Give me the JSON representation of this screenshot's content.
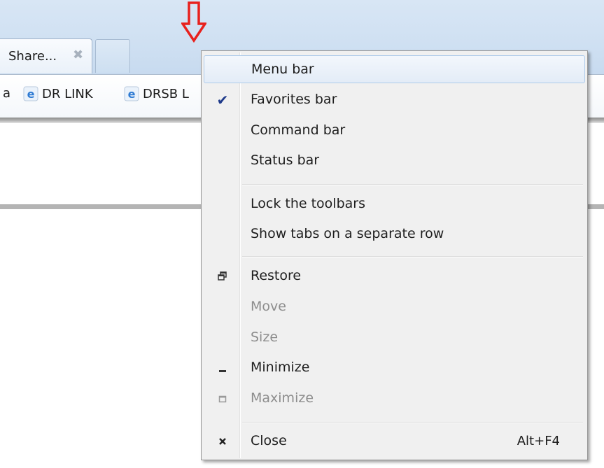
{
  "tab": {
    "label": "Share...",
    "close_glyph": "✖"
  },
  "favorites": [
    {
      "label": "a"
    },
    {
      "label": "DR LINK",
      "icon": "ie-icon"
    },
    {
      "label": "DRSB L",
      "icon": "ie-icon"
    }
  ],
  "menu": {
    "items": [
      {
        "label": "Menu bar",
        "checked": false,
        "highlighted": true
      },
      {
        "label": "Favorites bar",
        "checked": true
      },
      {
        "label": "Command bar"
      },
      {
        "label": "Status bar"
      },
      {
        "label": "Lock the toolbars"
      },
      {
        "label": "Show tabs on a separate row"
      },
      {
        "label": "Restore",
        "icon": "restore-icon"
      },
      {
        "label": "Move",
        "disabled": true
      },
      {
        "label": "Size",
        "disabled": true
      },
      {
        "label": "Minimize",
        "icon": "minimize-icon"
      },
      {
        "label": "Maximize",
        "icon": "maximize-icon",
        "disabled": true
      },
      {
        "label": "Close",
        "icon": "close-icon",
        "shortcut": "Alt+F4"
      }
    ],
    "check_glyph": "✔"
  },
  "colors": {
    "annotation_arrow": "#e8211d",
    "highlight_border": "#aecbea",
    "check": "#1f3a8a"
  }
}
